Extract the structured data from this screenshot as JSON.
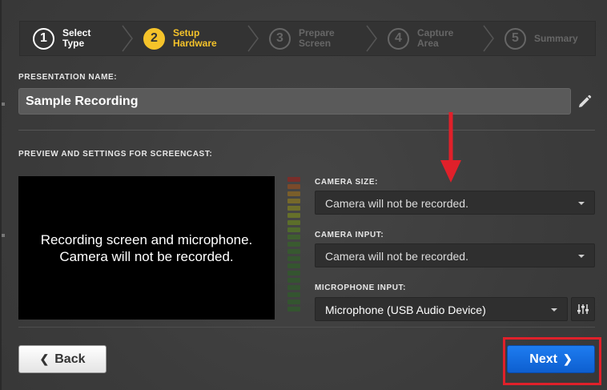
{
  "steps": [
    {
      "number": "1",
      "label": "Select Type",
      "state": "done"
    },
    {
      "number": "2",
      "label": "Setup Hardware",
      "state": "active"
    },
    {
      "number": "3",
      "label": "Prepare Screen",
      "state": "pending"
    },
    {
      "number": "4",
      "label": "Capture Area",
      "state": "pending"
    },
    {
      "number": "5",
      "label": "Summary",
      "state": "pending"
    }
  ],
  "presentation": {
    "label": "PRESENTATION NAME:",
    "value": "Sample Recording"
  },
  "preview": {
    "label": "PREVIEW AND SETTINGS FOR SCREENCAST:",
    "message_line1": "Recording screen and microphone.",
    "message_line2": "Camera will not be recorded."
  },
  "camera_size": {
    "label": "CAMERA SIZE:",
    "value": "Camera will not be recorded."
  },
  "camera_input": {
    "label": "CAMERA INPUT:",
    "value": "Camera will not be recorded."
  },
  "microphone_input": {
    "label": "MICROPHONE INPUT:",
    "value": "Microphone (USB Audio Device)"
  },
  "buttons": {
    "back": "Back",
    "next": "Next"
  },
  "colors": {
    "active_step": "#f5c32a",
    "next_button": "#1a72e8",
    "highlight": "#e0202a"
  },
  "icons": {
    "edit": "pencil-icon",
    "mixer": "sliders-icon",
    "back": "chevron-left-icon",
    "next": "chevron-right-icon"
  }
}
